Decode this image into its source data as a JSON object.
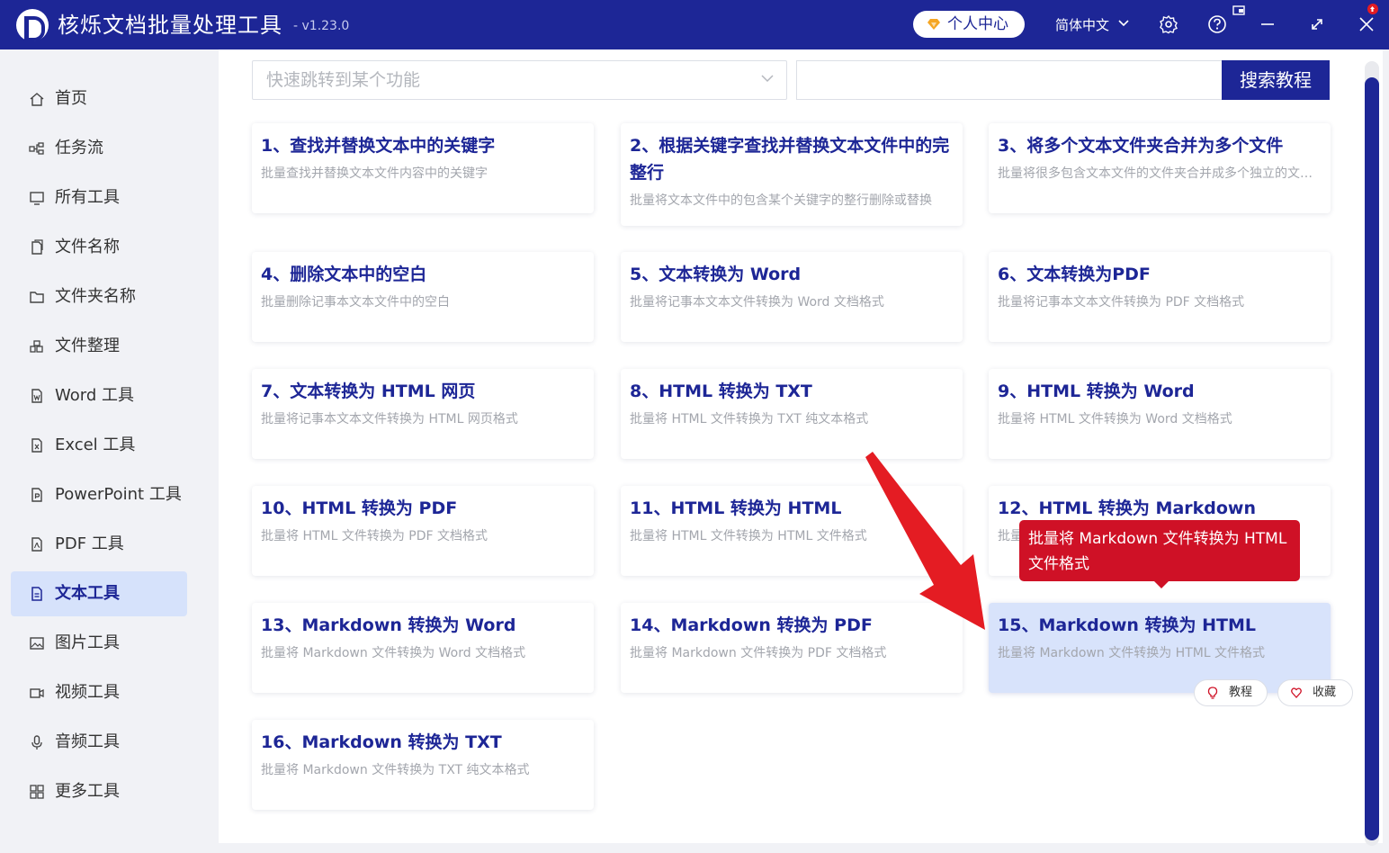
{
  "app": {
    "title": "核烁文档批量处理工具",
    "version": "- v1.23.0",
    "user_center": "个人中心",
    "language": "简体中文"
  },
  "sidebar": {
    "items": [
      {
        "label": "首页",
        "icon": "home-icon"
      },
      {
        "label": "任务流",
        "icon": "workflow-icon"
      },
      {
        "label": "所有工具",
        "icon": "monitor-icon"
      },
      {
        "label": "文件名称",
        "icon": "file-rename-icon"
      },
      {
        "label": "文件夹名称",
        "icon": "folder-icon"
      },
      {
        "label": "文件整理",
        "icon": "organize-icon"
      },
      {
        "label": "Word 工具",
        "icon": "word-icon"
      },
      {
        "label": "Excel 工具",
        "icon": "excel-icon"
      },
      {
        "label": "PowerPoint 工具",
        "icon": "ppt-icon"
      },
      {
        "label": "PDF 工具",
        "icon": "pdf-icon"
      },
      {
        "label": "文本工具",
        "icon": "text-file-icon",
        "active": true
      },
      {
        "label": "图片工具",
        "icon": "image-icon"
      },
      {
        "label": "视频工具",
        "icon": "video-icon"
      },
      {
        "label": "音频工具",
        "icon": "microphone-icon"
      },
      {
        "label": "更多工具",
        "icon": "grid-icon"
      }
    ]
  },
  "search": {
    "jump_placeholder": "快速跳转到某个功能",
    "button": "搜索教程"
  },
  "cards": [
    {
      "title": "1、查找并替换文本中的关键字",
      "desc": "批量查找并替换文本文件内容中的关键字"
    },
    {
      "title": "2、根据关键字查找并替换文本文件中的完整行",
      "desc": "批量将文本文件中的包含某个关键字的整行删除或替换"
    },
    {
      "title": "3、将多个文本文件夹合并为多个文件",
      "desc": "批量将很多包含文本文件的文件夹合并成多个独立的文本文件"
    },
    {
      "title": "4、删除文本中的空白",
      "desc": "批量删除记事本文本文件中的空白"
    },
    {
      "title": "5、文本转换为 Word",
      "desc": "批量将记事本文本文件转换为 Word 文档格式"
    },
    {
      "title": "6、文本转换为PDF",
      "desc": "批量将记事本文本文件转换为 PDF 文档格式"
    },
    {
      "title": "7、文本转换为 HTML 网页",
      "desc": "批量将记事本文本文件转换为 HTML 网页格式"
    },
    {
      "title": "8、HTML 转换为 TXT",
      "desc": "批量将 HTML 文件转换为 TXT 纯文本格式"
    },
    {
      "title": "9、HTML 转换为 Word",
      "desc": "批量将 HTML 文件转换为 Word 文档格式"
    },
    {
      "title": "10、HTML 转换为 PDF",
      "desc": "批量将 HTML 文件转换为 PDF 文档格式"
    },
    {
      "title": "11、HTML 转换为 HTML",
      "desc": "批量将 HTML 文件转换为 HTML 文件格式"
    },
    {
      "title": "12、HTML 转换为 Markdown",
      "desc": "批量将 HTML 文件转换为 Markdown 文件格式"
    },
    {
      "title": "13、Markdown 转换为 Word",
      "desc": "批量将 Markdown 文件转换为 Word 文档格式"
    },
    {
      "title": "14、Markdown 转换为 PDF",
      "desc": "批量将 Markdown 文件转换为 PDF 文档格式"
    },
    {
      "title": "15、Markdown 转换为 HTML",
      "desc": "批量将 Markdown 文件转换为 HTML 文件格式",
      "highlight": true
    },
    {
      "title": "16、Markdown 转换为 TXT",
      "desc": "批量将 Markdown 文件转换为 TXT 纯文本格式"
    }
  ],
  "card_actions": {
    "tutorial": "教程",
    "favorite": "收藏"
  },
  "tooltip": "批量将 Markdown 文件转换为 HTML 文件格式",
  "colors": {
    "brand": "#1d2696",
    "highlight": "#d8e3fb",
    "tooltip": "#cf1126",
    "arrow": "#e41c23"
  }
}
